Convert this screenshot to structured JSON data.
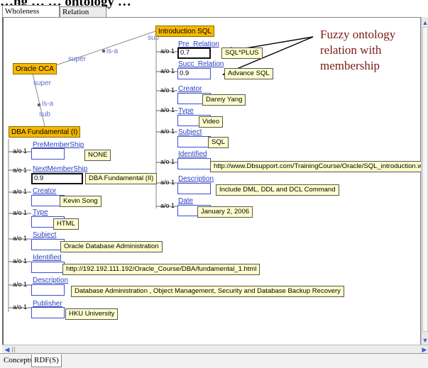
{
  "header": {
    "title": "…ng … … ontology …"
  },
  "tabs": [
    "Wholeness Concept",
    "Relation Concept"
  ],
  "graph": {
    "nodes": {
      "intro_sql": "Introduction SQL",
      "oracle_oca": "Oracle OCA",
      "dba_fundamental": "DBA Fundamental (I)"
    },
    "edges": {
      "sub_top": "sub",
      "super_top": "super",
      "isa_top": "is-a",
      "super_left": "super",
      "isa_left": "is-a",
      "sub_left": "sub"
    },
    "cardinality": "a/o 1",
    "intro_slots": [
      {
        "name": "Pre_Relation",
        "box": "0.7",
        "value": "SQL*PLUS"
      },
      {
        "name": "Succ_Relation",
        "box": "0.9",
        "value": "Advance SQL"
      },
      {
        "name": "Creator",
        "box": "",
        "value": "Danny Yang"
      },
      {
        "name": "Type",
        "box": "",
        "value": "Video"
      },
      {
        "name": "Subject",
        "box": "",
        "value": "SQL"
      },
      {
        "name": "Identified",
        "box": "",
        "value": "http://www.Dbsupport.com/TrainingCourse/Oracle/SQL_introduction.wmv"
      },
      {
        "name": "Description",
        "box": "",
        "value": "Include DML, DDL and DCL Command"
      },
      {
        "name": "Date",
        "box": "",
        "value": "January 2, 2006"
      }
    ],
    "dba_slots": [
      {
        "name": "PreMemberShip",
        "box": "",
        "value": "NONE"
      },
      {
        "name": "NextMemberShip",
        "box": "0.9",
        "value": "DBA Fundamental (II)"
      },
      {
        "name": "Creator",
        "box": "",
        "value": "Kevin Song"
      },
      {
        "name": "Type",
        "box": "",
        "value": "HTML"
      },
      {
        "name": "Subject",
        "box": "",
        "value": "Oracle Database Administration"
      },
      {
        "name": "Identified",
        "box": "",
        "value": "http://192.192.111.192/Oracle_Course/DBA/fundamental_1.html"
      },
      {
        "name": "Description",
        "box": "",
        "value": "Database Administration , Object Management, Security and Database  Backup Recovery"
      },
      {
        "name": "Publisher",
        "box": "",
        "value": "HKU University"
      }
    ]
  },
  "annotation": {
    "text": "Fuzzy ontology relation with membership"
  },
  "bottom_tabs": [
    "Concepts",
    "RDF(S)"
  ],
  "icons": {
    "scroll_up": "▲",
    "scroll_down": "▼",
    "scroll_left": "◀",
    "scroll_right": "▶"
  },
  "colors": {
    "node_fill": "#f7b800",
    "value_fill": "#ffffcc",
    "slot_border": "#3a4fcf",
    "annotation": "#7a1a14",
    "edge": "#888888"
  }
}
